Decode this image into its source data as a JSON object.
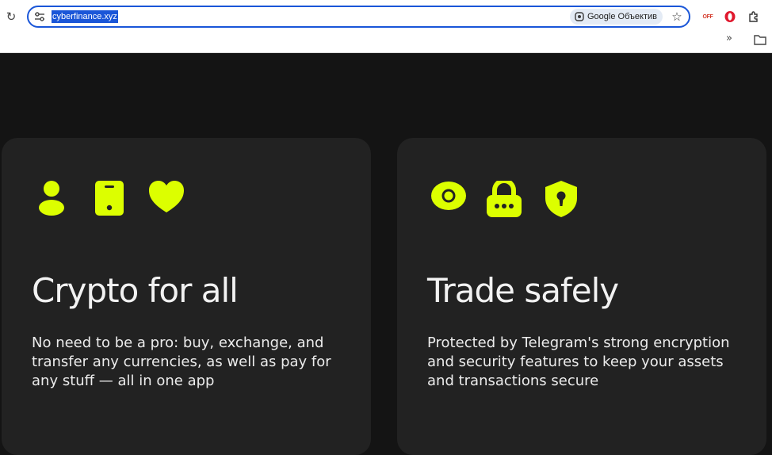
{
  "browser": {
    "url": "cyberfinance.xyz",
    "lens_label": "Google Объектив",
    "extensions": {
      "vpn_badge": "OFF"
    }
  },
  "colors": {
    "accent": "#dcff00",
    "card_background": "#222222",
    "page_background": "#141414"
  },
  "cards": [
    {
      "icons": [
        "user-icon",
        "phone-icon",
        "heart-icon"
      ],
      "title": "Crypto for all",
      "description": "No need to be a pro: buy, exchange, and transfer any currencies, as well as pay for any stuff — all in one app"
    },
    {
      "icons": [
        "eye-icon",
        "lock-icon",
        "shield-keyhole-icon"
      ],
      "title": "Trade safely",
      "description": "Protected by Telegram's strong encryption and security features to keep your assets and transactions secure"
    }
  ]
}
